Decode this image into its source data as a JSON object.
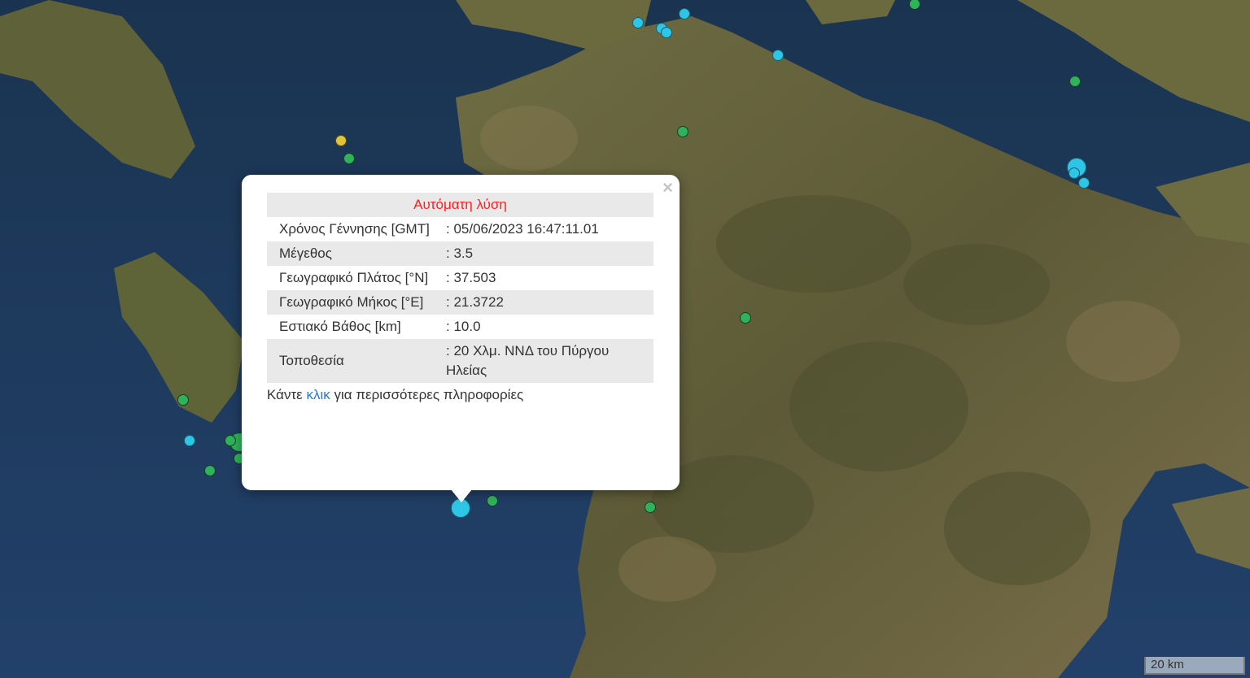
{
  "popup": {
    "header": "Αυτόματη λύση",
    "close_glyph": "×",
    "rows": [
      {
        "label": "Χρόνος Γέννησης [GMT]",
        "value": ": 05/06/2023 16:47:11.01"
      },
      {
        "label": "Μέγεθος",
        "value": ": 3.5"
      },
      {
        "label": "Γεωγραφικό Πλάτος [°N]",
        "value": ": 37.503"
      },
      {
        "label": "Γεωγραφικό Μήκος [°E]",
        "value": ": 21.3722"
      },
      {
        "label": "Εστιακό Βάθος [km]",
        "value": ": 10.0"
      },
      {
        "label": "Τοποθεσία",
        "value": ": 20 Χλμ. ΝΝΔ του Πύργου Ηλείας"
      }
    ],
    "footer_prefix": "Κάντε ",
    "footer_link": "κλικ",
    "footer_suffix": " για περισσότερες πληροφορίες"
  },
  "scale": {
    "label": "20 km"
  },
  "colors": {
    "sea": "#1f3a5e",
    "land": "#6b6a3f",
    "marker_green": "#2fb35a",
    "marker_cyan": "#2ec6e6",
    "marker_yellow": "#e1c43a",
    "header_red": "#ff1f1f",
    "link_blue": "#2a77c9"
  }
}
